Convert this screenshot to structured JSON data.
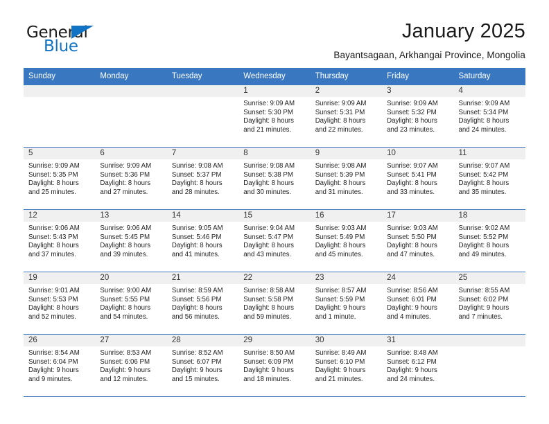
{
  "logo": {
    "line1": "General",
    "line2": "Blue",
    "triangle_icon": "blue-triangle-icon"
  },
  "header": {
    "title": "January 2025",
    "subtitle": "Bayantsagaan, Arkhangai Province, Mongolia"
  },
  "colors": {
    "header_blue": "#3978c0",
    "logo_blue": "#1273c4",
    "day_band_gray": "#f0f0f0"
  },
  "weekdays": [
    "Sunday",
    "Monday",
    "Tuesday",
    "Wednesday",
    "Thursday",
    "Friday",
    "Saturday"
  ],
  "weeks": [
    [
      {
        "day": "",
        "empty": true
      },
      {
        "day": "",
        "empty": true
      },
      {
        "day": "",
        "empty": true
      },
      {
        "day": "1",
        "sunrise": "Sunrise: 9:09 AM",
        "sunset": "Sunset: 5:30 PM",
        "daylight1": "Daylight: 8 hours",
        "daylight2": "and 21 minutes."
      },
      {
        "day": "2",
        "sunrise": "Sunrise: 9:09 AM",
        "sunset": "Sunset: 5:31 PM",
        "daylight1": "Daylight: 8 hours",
        "daylight2": "and 22 minutes."
      },
      {
        "day": "3",
        "sunrise": "Sunrise: 9:09 AM",
        "sunset": "Sunset: 5:32 PM",
        "daylight1": "Daylight: 8 hours",
        "daylight2": "and 23 minutes."
      },
      {
        "day": "4",
        "sunrise": "Sunrise: 9:09 AM",
        "sunset": "Sunset: 5:34 PM",
        "daylight1": "Daylight: 8 hours",
        "daylight2": "and 24 minutes."
      }
    ],
    [
      {
        "day": "5",
        "sunrise": "Sunrise: 9:09 AM",
        "sunset": "Sunset: 5:35 PM",
        "daylight1": "Daylight: 8 hours",
        "daylight2": "and 25 minutes."
      },
      {
        "day": "6",
        "sunrise": "Sunrise: 9:09 AM",
        "sunset": "Sunset: 5:36 PM",
        "daylight1": "Daylight: 8 hours",
        "daylight2": "and 27 minutes."
      },
      {
        "day": "7",
        "sunrise": "Sunrise: 9:08 AM",
        "sunset": "Sunset: 5:37 PM",
        "daylight1": "Daylight: 8 hours",
        "daylight2": "and 28 minutes."
      },
      {
        "day": "8",
        "sunrise": "Sunrise: 9:08 AM",
        "sunset": "Sunset: 5:38 PM",
        "daylight1": "Daylight: 8 hours",
        "daylight2": "and 30 minutes."
      },
      {
        "day": "9",
        "sunrise": "Sunrise: 9:08 AM",
        "sunset": "Sunset: 5:39 PM",
        "daylight1": "Daylight: 8 hours",
        "daylight2": "and 31 minutes."
      },
      {
        "day": "10",
        "sunrise": "Sunrise: 9:07 AM",
        "sunset": "Sunset: 5:41 PM",
        "daylight1": "Daylight: 8 hours",
        "daylight2": "and 33 minutes."
      },
      {
        "day": "11",
        "sunrise": "Sunrise: 9:07 AM",
        "sunset": "Sunset: 5:42 PM",
        "daylight1": "Daylight: 8 hours",
        "daylight2": "and 35 minutes."
      }
    ],
    [
      {
        "day": "12",
        "sunrise": "Sunrise: 9:06 AM",
        "sunset": "Sunset: 5:43 PM",
        "daylight1": "Daylight: 8 hours",
        "daylight2": "and 37 minutes."
      },
      {
        "day": "13",
        "sunrise": "Sunrise: 9:06 AM",
        "sunset": "Sunset: 5:45 PM",
        "daylight1": "Daylight: 8 hours",
        "daylight2": "and 39 minutes."
      },
      {
        "day": "14",
        "sunrise": "Sunrise: 9:05 AM",
        "sunset": "Sunset: 5:46 PM",
        "daylight1": "Daylight: 8 hours",
        "daylight2": "and 41 minutes."
      },
      {
        "day": "15",
        "sunrise": "Sunrise: 9:04 AM",
        "sunset": "Sunset: 5:47 PM",
        "daylight1": "Daylight: 8 hours",
        "daylight2": "and 43 minutes."
      },
      {
        "day": "16",
        "sunrise": "Sunrise: 9:03 AM",
        "sunset": "Sunset: 5:49 PM",
        "daylight1": "Daylight: 8 hours",
        "daylight2": "and 45 minutes."
      },
      {
        "day": "17",
        "sunrise": "Sunrise: 9:03 AM",
        "sunset": "Sunset: 5:50 PM",
        "daylight1": "Daylight: 8 hours",
        "daylight2": "and 47 minutes."
      },
      {
        "day": "18",
        "sunrise": "Sunrise: 9:02 AM",
        "sunset": "Sunset: 5:52 PM",
        "daylight1": "Daylight: 8 hours",
        "daylight2": "and 49 minutes."
      }
    ],
    [
      {
        "day": "19",
        "sunrise": "Sunrise: 9:01 AM",
        "sunset": "Sunset: 5:53 PM",
        "daylight1": "Daylight: 8 hours",
        "daylight2": "and 52 minutes."
      },
      {
        "day": "20",
        "sunrise": "Sunrise: 9:00 AM",
        "sunset": "Sunset: 5:55 PM",
        "daylight1": "Daylight: 8 hours",
        "daylight2": "and 54 minutes."
      },
      {
        "day": "21",
        "sunrise": "Sunrise: 8:59 AM",
        "sunset": "Sunset: 5:56 PM",
        "daylight1": "Daylight: 8 hours",
        "daylight2": "and 56 minutes."
      },
      {
        "day": "22",
        "sunrise": "Sunrise: 8:58 AM",
        "sunset": "Sunset: 5:58 PM",
        "daylight1": "Daylight: 8 hours",
        "daylight2": "and 59 minutes."
      },
      {
        "day": "23",
        "sunrise": "Sunrise: 8:57 AM",
        "sunset": "Sunset: 5:59 PM",
        "daylight1": "Daylight: 9 hours",
        "daylight2": "and 1 minute."
      },
      {
        "day": "24",
        "sunrise": "Sunrise: 8:56 AM",
        "sunset": "Sunset: 6:01 PM",
        "daylight1": "Daylight: 9 hours",
        "daylight2": "and 4 minutes."
      },
      {
        "day": "25",
        "sunrise": "Sunrise: 8:55 AM",
        "sunset": "Sunset: 6:02 PM",
        "daylight1": "Daylight: 9 hours",
        "daylight2": "and 7 minutes."
      }
    ],
    [
      {
        "day": "26",
        "sunrise": "Sunrise: 8:54 AM",
        "sunset": "Sunset: 6:04 PM",
        "daylight1": "Daylight: 9 hours",
        "daylight2": "and 9 minutes."
      },
      {
        "day": "27",
        "sunrise": "Sunrise: 8:53 AM",
        "sunset": "Sunset: 6:06 PM",
        "daylight1": "Daylight: 9 hours",
        "daylight2": "and 12 minutes."
      },
      {
        "day": "28",
        "sunrise": "Sunrise: 8:52 AM",
        "sunset": "Sunset: 6:07 PM",
        "daylight1": "Daylight: 9 hours",
        "daylight2": "and 15 minutes."
      },
      {
        "day": "29",
        "sunrise": "Sunrise: 8:50 AM",
        "sunset": "Sunset: 6:09 PM",
        "daylight1": "Daylight: 9 hours",
        "daylight2": "and 18 minutes."
      },
      {
        "day": "30",
        "sunrise": "Sunrise: 8:49 AM",
        "sunset": "Sunset: 6:10 PM",
        "daylight1": "Daylight: 9 hours",
        "daylight2": "and 21 minutes."
      },
      {
        "day": "31",
        "sunrise": "Sunrise: 8:48 AM",
        "sunset": "Sunset: 6:12 PM",
        "daylight1": "Daylight: 9 hours",
        "daylight2": "and 24 minutes."
      },
      {
        "day": "",
        "empty": true
      }
    ]
  ]
}
